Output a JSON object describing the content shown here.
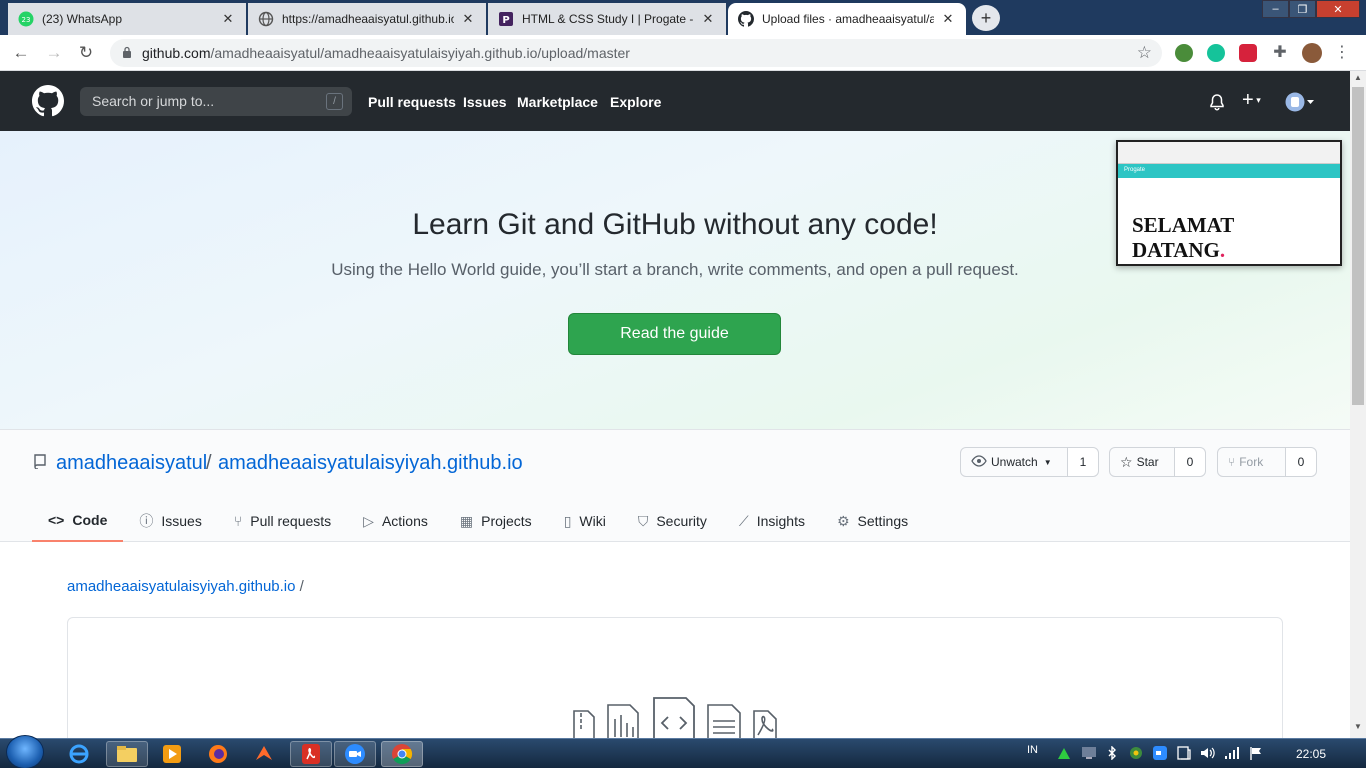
{
  "browser": {
    "tabs": [
      {
        "title": "(23) WhatsApp",
        "badge": "23",
        "active": false
      },
      {
        "title": "https://amadheaaisyatul.github.io",
        "active": false
      },
      {
        "title": "HTML & CSS Study I | Progate - L",
        "active": false
      },
      {
        "title": "Upload files · amadheaaisyatul/am",
        "active": true
      }
    ],
    "tab_close": "✕",
    "new_tab": "+",
    "window_buttons": [
      "–",
      "❐",
      "✕"
    ],
    "url_host": "github.com",
    "url_path": "/amadheaaisyatul/amadheaaisyatulaisyiyah.github.io/upload/master"
  },
  "github": {
    "search_placeholder": "Search or jump to...",
    "search_shortcut": "/",
    "nav": [
      "Pull requests",
      "Issues",
      "Marketplace",
      "Explore"
    ],
    "plus": "+"
  },
  "hero": {
    "title": "Learn Git and GitHub without any code!",
    "subtitle": "Using the Hello World guide, you’ll start a branch, write comments, and open a pull request.",
    "button": "Read the guide"
  },
  "preview": {
    "site_name": "Progate",
    "line1": "SELAMAT",
    "line2": "DATANG",
    "dot": "."
  },
  "repo": {
    "owner": "amadheaaisyatul",
    "separator": "/",
    "name": "amadheaaisyatulaisyiyah.github.io",
    "watch_label": "Unwatch",
    "watch_count": "1",
    "star_label": "Star",
    "star_count": "0",
    "fork_label": "Fork",
    "fork_count": "0",
    "tabs": [
      {
        "label": "Code",
        "icon": "code-icon",
        "glyph": "<>",
        "selected": true
      },
      {
        "label": "Issues",
        "icon": "issue-icon",
        "glyph": "ⓘ"
      },
      {
        "label": "Pull requests",
        "icon": "pull-request-icon",
        "glyph": "⑂"
      },
      {
        "label": "Actions",
        "icon": "play-icon",
        "glyph": "▷"
      },
      {
        "label": "Projects",
        "icon": "project-icon",
        "glyph": "▦"
      },
      {
        "label": "Wiki",
        "icon": "book-icon",
        "glyph": "▯"
      },
      {
        "label": "Security",
        "icon": "shield-icon",
        "glyph": "⛉"
      },
      {
        "label": "Insights",
        "icon": "graph-icon",
        "glyph": "⟋"
      },
      {
        "label": "Settings",
        "icon": "gear-icon",
        "glyph": "⚙"
      }
    ]
  },
  "upload": {
    "breadcrumb": "amadheaaisyatulaisyiyah.github.io",
    "breadcrumb_sep": "/"
  },
  "taskbar": {
    "language": "IN",
    "time": "22:05"
  },
  "colors": {
    "github_header": "#24292e",
    "primary_button": "#2ea44f",
    "link": "#0366d6",
    "selected_tab_underline": "#f9826c"
  }
}
